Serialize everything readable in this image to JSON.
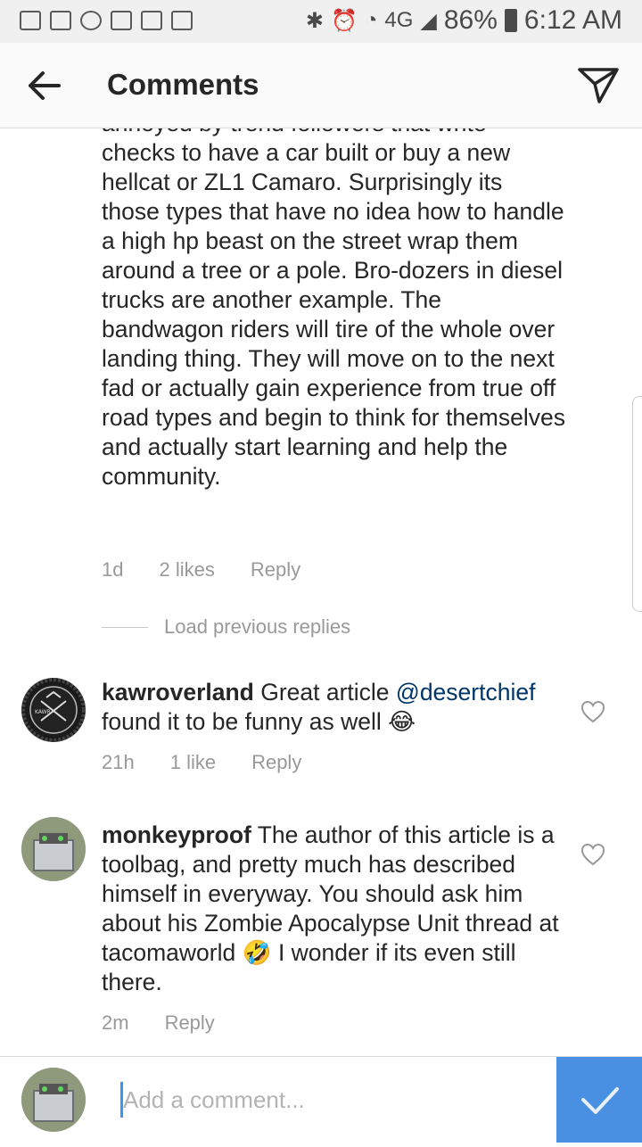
{
  "status_bar": {
    "left_icons": [
      "mail-icon",
      "gmail-icon",
      "chase-icon",
      "image-icon",
      "calendar-icon",
      "refresh-icon"
    ],
    "network": "4G",
    "battery": "86%",
    "time": "6:12 AM"
  },
  "header": {
    "title": "Comments"
  },
  "reply": {
    "text": "annoyed by trend followers that write checks to have a car built or buy a new hellcat or ZL1 Camaro. Surprisingly its those types that have no idea how to handle a high hp beast on the street wrap them around a tree or a pole.  Bro-dozers in diesel trucks are another example.  The bandwagon riders will tire of the whole over landing thing. They will move on to the next fad or actually gain experience from true off road types and begin to think for themselves and actually start learning and help the community.",
    "time": "1d",
    "likes": "2 likes",
    "reply_label": "Reply"
  },
  "load_previous": "Load previous replies",
  "comments": [
    {
      "username": "kawroverland",
      "text_before": " Great article ",
      "mention": "@desertchief",
      "text_after": " found it to be funny as well 😂",
      "time": "21h",
      "likes": "1 like",
      "reply_label": "Reply",
      "avatar_label": "KAWR"
    },
    {
      "username": "monkeyproof",
      "text": " The author of this article is a toolbag, and pretty much has described himself in everyway. You should ask him about his Zombie Apocalypse Unit  thread at tacomaworld 🤣 I wonder if its even still there.",
      "time": "2m",
      "reply_label": "Reply"
    }
  ],
  "composer": {
    "placeholder": "Add a comment..."
  }
}
